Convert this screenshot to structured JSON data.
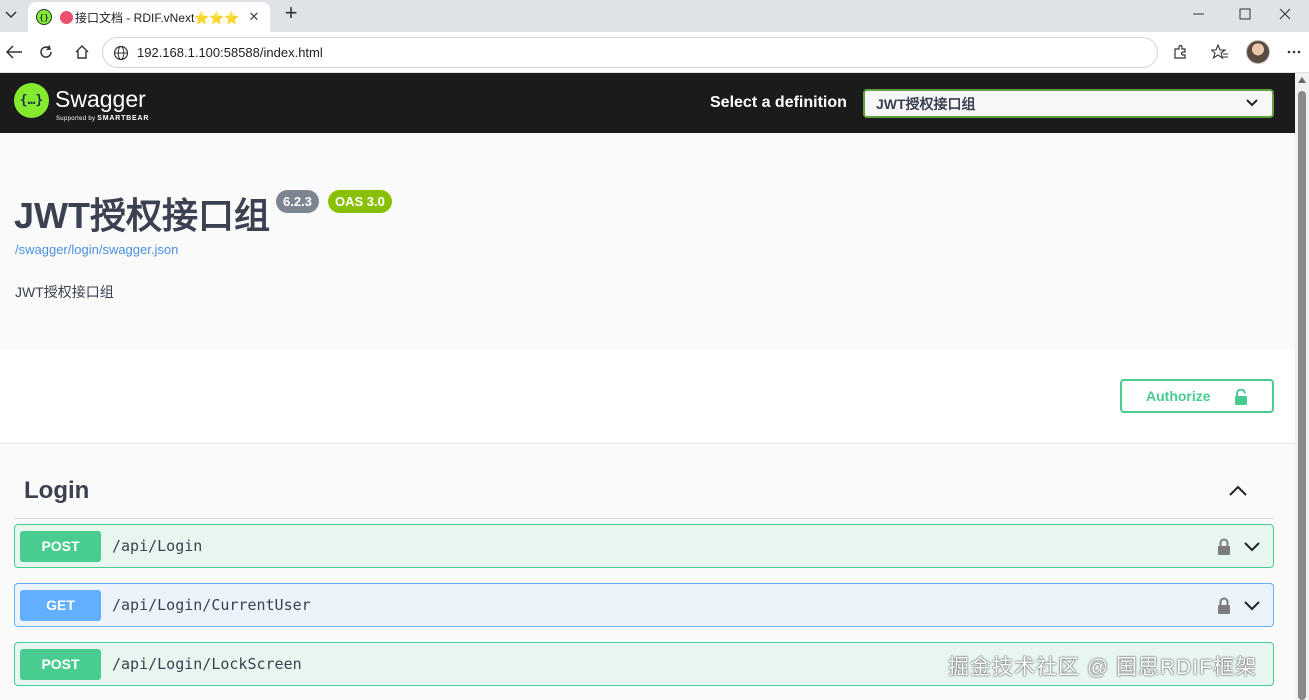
{
  "browser": {
    "tab": {
      "title": "接口文档 - RDIF.vNext⭐⭐⭐",
      "close_glyph": "✕",
      "favicon": "swagger-favicon"
    },
    "new_tab_glyph": "+",
    "address": "192.168.1.100:58588/index.html"
  },
  "swagger": {
    "logo_text": "Swagger",
    "logo_sub_prefix": "Supported by ",
    "logo_sub_brand": "SMARTBEAR",
    "logo_glyph": "{…}",
    "select_label": "Select a definition",
    "selected_definition": "JWT授权接口组"
  },
  "info": {
    "title": "JWT授权接口组",
    "version": "6.2.3",
    "oas": "OAS 3.0",
    "url": "/swagger/login/swagger.json",
    "description": "JWT授权接口组"
  },
  "authorize": {
    "label": "Authorize"
  },
  "tag": {
    "name": "Login"
  },
  "operations": [
    {
      "method": "POST",
      "path": "/api/Login"
    },
    {
      "method": "GET",
      "path": "/api/Login/CurrentUser"
    },
    {
      "method": "POST",
      "path": "/api/Login/LockScreen"
    }
  ],
  "watermark": "掘金技术社区 @ 国思RDIF框架",
  "colors": {
    "post": "#49cc90",
    "get": "#61affe",
    "swagger_green": "#85ea2d",
    "topbar": "#1b1b1b",
    "version_badge": "#7d8492",
    "oas_badge": "#89bf04",
    "link": "#4990e2"
  }
}
